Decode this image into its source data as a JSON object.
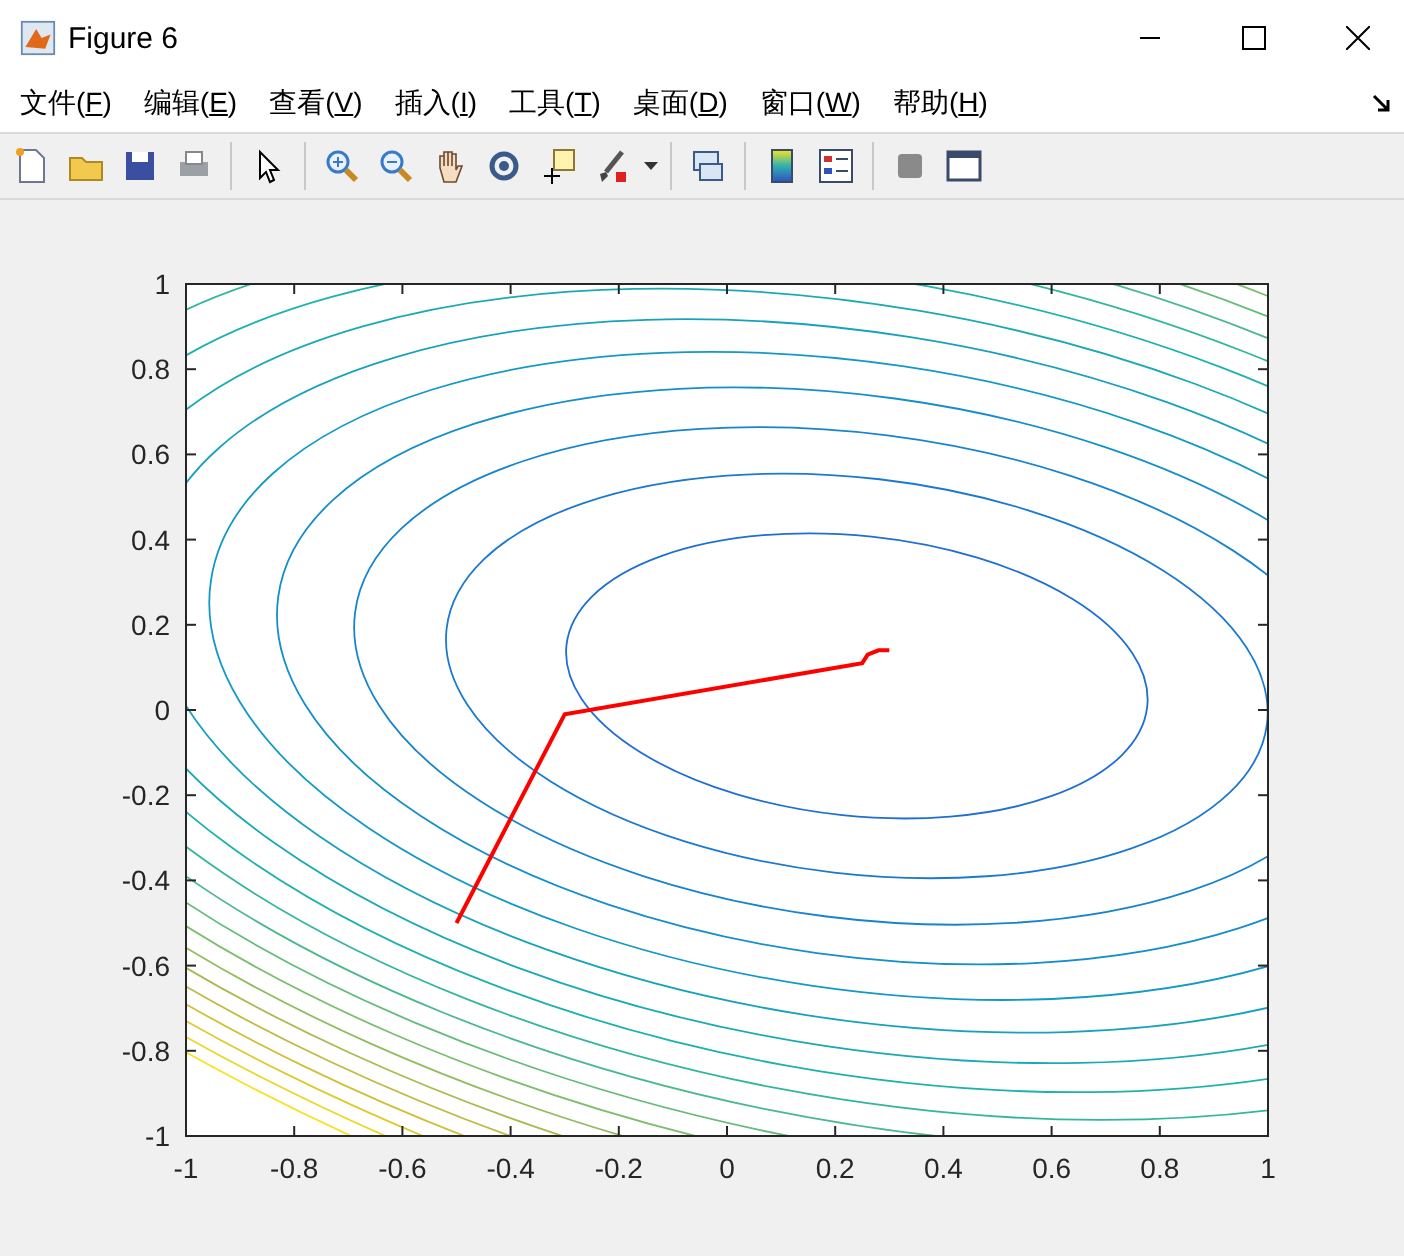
{
  "window": {
    "title": "Figure 6"
  },
  "menu": [
    "文件(F)",
    "编辑(E)",
    "查看(V)",
    "插入(I)",
    "工具(T)",
    "桌面(D)",
    "窗口(W)",
    "帮助(H)"
  ],
  "plot": {
    "chart_data": {
      "type": "line",
      "xlim": [
        -1,
        1
      ],
      "ylim": [
        -1,
        1
      ],
      "xticks": [
        -1,
        -0.8,
        -0.6,
        -0.4,
        -0.2,
        0,
        0.2,
        0.4,
        0.6,
        0.8,
        1
      ],
      "yticks": [
        -1,
        -0.8,
        -0.6,
        -0.4,
        -0.2,
        0,
        0.2,
        0.4,
        0.6,
        0.8,
        1
      ],
      "x": [
        -0.5,
        -0.3,
        0.25,
        0.26,
        0.28,
        0.3
      ],
      "series": [
        {
          "color": "#ff0000",
          "values": [
            -0.5,
            -0.01,
            0.11,
            0.13,
            0.14,
            0.14
          ]
        }
      ]
    }
  }
}
